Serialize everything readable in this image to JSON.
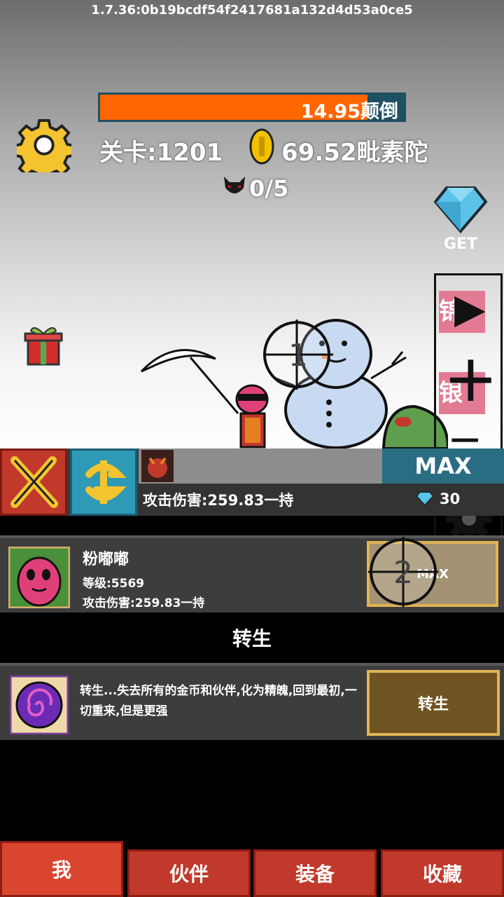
{
  "version_string": "1.7.36:0b19bcdf54f2417681a132d4d53a0ce5",
  "boss": {
    "hp_text": "14.95颠倒",
    "hp_fraction": 0.88
  },
  "stats": {
    "stage_label": "关卡:1201",
    "gold_amount": "69.52毗素陀",
    "kills": "0/5"
  },
  "gem_button_label": "GET",
  "side_panel": {
    "play_glyph": "▶",
    "plus_glyph": "+",
    "minus_glyph": "−",
    "next_glyph": "›",
    "peek_labels": [
      "锦",
      "银"
    ]
  },
  "crosshair_labels": [
    "1",
    "2"
  ],
  "hero_bar": {
    "max_label": "MAX",
    "damage_text": "攻击伤害:259.83一持",
    "gem_cost": "30"
  },
  "partner": {
    "name": "粉嘟嘟",
    "level": "等级:5569",
    "damage": "攻击伤害:259.83一持",
    "button_label": "MAX"
  },
  "rebirth": {
    "section_title": "转生",
    "description": "转生...失去所有的金币和伙伴,化为精魄,回到最初,一切重来,但是更强",
    "button_label": "转生"
  },
  "tabs": [
    {
      "label": "我",
      "active": true
    },
    {
      "label": "伙伴",
      "active": false
    },
    {
      "label": "装备",
      "active": false
    },
    {
      "label": "收藏",
      "active": false
    }
  ],
  "colors": {
    "hp_fill": "#ff6600",
    "tab_red": "#c0392b",
    "gold_button": "#6f5422",
    "max_button": "#2a6c82"
  }
}
